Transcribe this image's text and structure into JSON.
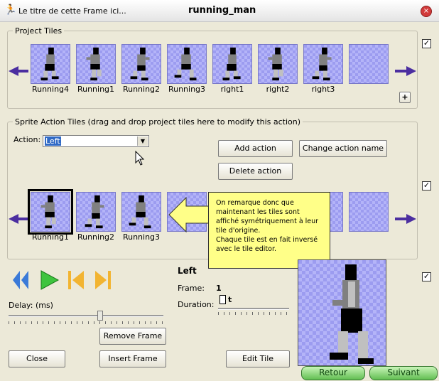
{
  "window": {
    "subtitle": "Le titre de cette Frame ici...",
    "title": "running_man",
    "close_symbol": "×"
  },
  "project_tiles": {
    "group_label": "Project Tiles",
    "tiles": [
      {
        "label": "Running4",
        "pose": "a"
      },
      {
        "label": "Running1",
        "pose": "b"
      },
      {
        "label": "Running2",
        "pose": "c"
      },
      {
        "label": "Running3",
        "pose": "d"
      },
      {
        "label": "right1",
        "pose": "a"
      },
      {
        "label": "right2",
        "pose": "b"
      },
      {
        "label": "right3",
        "pose": "c"
      },
      {
        "label": "",
        "pose": "empty"
      }
    ],
    "add_label": "+"
  },
  "sprite_action": {
    "group_label": "Sprite Action Tiles (drag and drop project tiles here to modify this action)",
    "action_label": "Action:",
    "action_value": "Left",
    "add_action": "Add action",
    "change_action_name": "Change action name",
    "delete_action": "Delete action",
    "tiles": [
      {
        "label": "Running1",
        "pose": "b",
        "selected": true
      },
      {
        "label": "Running2",
        "pose": "c",
        "selected": false
      },
      {
        "label": "Running3",
        "pose": "d",
        "selected": false
      }
    ]
  },
  "callout": {
    "line1": "On remarque donc que",
    "line2": "maintenant les tiles sont",
    "line3": "affiché symétriquement à leur",
    "line4": "tile d'origine.",
    "line5": "Chaque tile est en fait inversé",
    "line6": "avec le tile editor."
  },
  "playback": {
    "delay_label": "Delay: (ms)",
    "remove_frame": "Remove Frame",
    "insert_frame": "Insert Frame",
    "close": "Close",
    "edit_tile": "Edit Tile"
  },
  "frame_info": {
    "action_name": "Left",
    "frame_label": "Frame:",
    "frame_value": "1",
    "duration_label": "Duration:",
    "duration_value": "t"
  },
  "nav": {
    "retour": "Retour",
    "suivant": "Suivant"
  },
  "checkboxes": {
    "checked_mark": "✓"
  },
  "colors": {
    "accent_arrow": "#4b2ea0",
    "tile_bg": "#9c9cf0",
    "callout_bg": "#ffff88",
    "nav_green": "#62be52"
  }
}
